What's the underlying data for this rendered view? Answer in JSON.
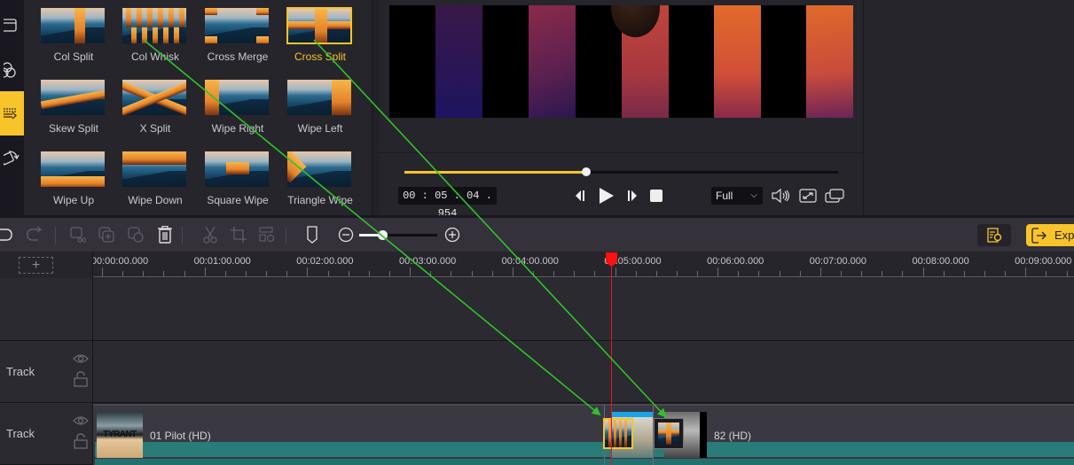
{
  "rail": {
    "items": [
      {
        "name": "media",
        "icon": "media-icon",
        "active": false
      },
      {
        "name": "effects",
        "icon": "effects-icon",
        "active": false
      },
      {
        "name": "transitions",
        "icon": "transitions-icon",
        "active": true
      },
      {
        "name": "overlays",
        "icon": "rotate-icon",
        "active": false
      }
    ]
  },
  "transitions": {
    "selected": "Cross Split",
    "items": [
      {
        "label": "Col Split",
        "style": "col-split"
      },
      {
        "label": "Col Whisk",
        "style": "col-whisk"
      },
      {
        "label": "Cross Merge",
        "style": "cross-merge"
      },
      {
        "label": "Cross Split",
        "style": "cross-split"
      },
      {
        "label": "Skew Split",
        "style": "skew-split"
      },
      {
        "label": "X Split",
        "style": "x-split"
      },
      {
        "label": "Wipe Right",
        "style": "wipe-right"
      },
      {
        "label": "Wipe Left",
        "style": "wipe-left"
      },
      {
        "label": "Wipe Up",
        "style": "wipe-up"
      },
      {
        "label": "Wipe Down",
        "style": "wipe-down"
      },
      {
        "label": "Square Wipe",
        "style": "square-wipe"
      },
      {
        "label": "Triangle Wipe",
        "style": "triangle-wipe"
      }
    ]
  },
  "player": {
    "timecode": "00 : 05 : 04 . 954",
    "progress_fraction": 0.42,
    "zoom_select": "Full",
    "buttons": {
      "prev_frame": "previous-frame",
      "play": "play",
      "next_frame": "next-frame",
      "stop": "stop",
      "volume": "volume",
      "fullscreen": "fullscreen",
      "detach": "pop-out"
    }
  },
  "toolbar": {
    "zoom_fraction": 0.3,
    "export_label": "Expo",
    "colors": {
      "accent": "#f7c42b"
    }
  },
  "timeline": {
    "ruler_labels": [
      "00:00:00.000",
      "00:01:00.000",
      "00:02:00.000",
      "00:03:00.000",
      "00:04:00.000",
      "00:05:00.000",
      "00:06:00.000",
      "00:07:00.000",
      "00:08:00.000",
      "00:09:00.000"
    ],
    "playhead_time": "00:05:04.954",
    "tracks": [
      {
        "name": "Track",
        "clips": []
      },
      {
        "name": "Track",
        "clips": [
          {
            "label": "01 Pilot (HD)",
            "thumb": "Tyrant poster"
          },
          {
            "label": "82 (HD)",
            "thumb": "episode poster"
          }
        ]
      }
    ],
    "applied_transitions": [
      "Col Whisk",
      "Cross Split"
    ]
  },
  "annotations": {
    "arrow_color": "#2fc22a"
  }
}
